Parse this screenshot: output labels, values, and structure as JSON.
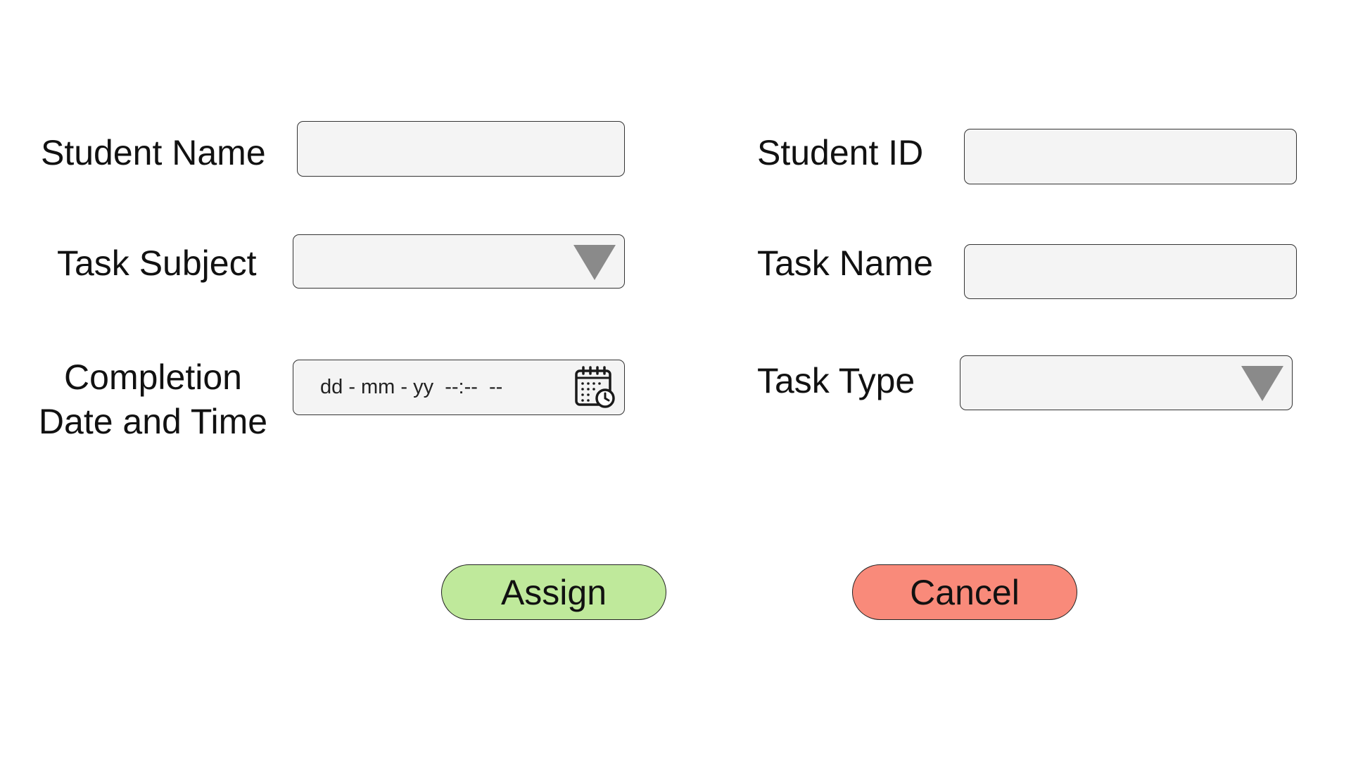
{
  "form": {
    "student_name": {
      "label": "Student Name",
      "value": ""
    },
    "student_id": {
      "label": "Student ID",
      "value": ""
    },
    "task_subject": {
      "label": "Task Subject",
      "value": ""
    },
    "task_name": {
      "label": "Task Name",
      "value": ""
    },
    "completion": {
      "label_line1": "Completion",
      "label_line2": "Date and Time",
      "placeholder": "dd - mm - yy  --:--  --"
    },
    "task_type": {
      "label": "Task Type",
      "value": ""
    }
  },
  "buttons": {
    "assign_label": "Assign",
    "cancel_label": "Cancel"
  },
  "icons": {
    "dropdown": "chevron-down-icon",
    "calendar": "calendar-clock-icon"
  },
  "colors": {
    "field_bg": "#f4f4f4",
    "dropdown_arrow": "#8a8a8a",
    "assign_bg": "#bfe99b",
    "cancel_bg": "#f98a7a"
  }
}
